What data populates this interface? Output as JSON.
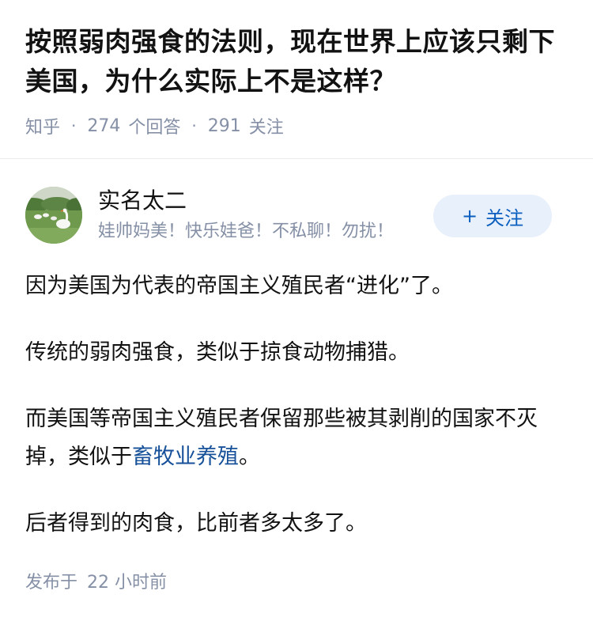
{
  "question": {
    "title": "按照弱肉强食的法则，现在世界上应该只剩下美国，为什么实际上不是这样？",
    "source": "知乎",
    "answers_count": "274",
    "answers_label": "个回答",
    "followers_count": "291",
    "followers_label": "关注"
  },
  "author": {
    "name": "实名太二",
    "bio": "娃帅妈美！快乐娃爸！不私聊！勿扰！",
    "avatar_icon": "avatar-photo-swans",
    "follow_label": "关注",
    "follow_icon": "+"
  },
  "answer": {
    "paragraph_1": "因为美国为代表的帝国主义殖民者“进化”了。",
    "paragraph_2": "传统的弱肉强食，类似于掠食动物捕猎。",
    "paragraph_3_text": "而美国等帝国主义殖民者保留那些被其剥削的国家不灭掉，类似于",
    "paragraph_3_link": "畜牧业养殖",
    "paragraph_3_end": "。",
    "paragraph_4": "后者得到的肉食，比前者多太多了。"
  },
  "footer": {
    "published_label": "发布于",
    "published_time": "22 小时前"
  },
  "colors": {
    "link": "#175199",
    "follow_text": "#0b5fbf",
    "follow_bg": "#e8f0fb",
    "muted": "#8590a6"
  }
}
